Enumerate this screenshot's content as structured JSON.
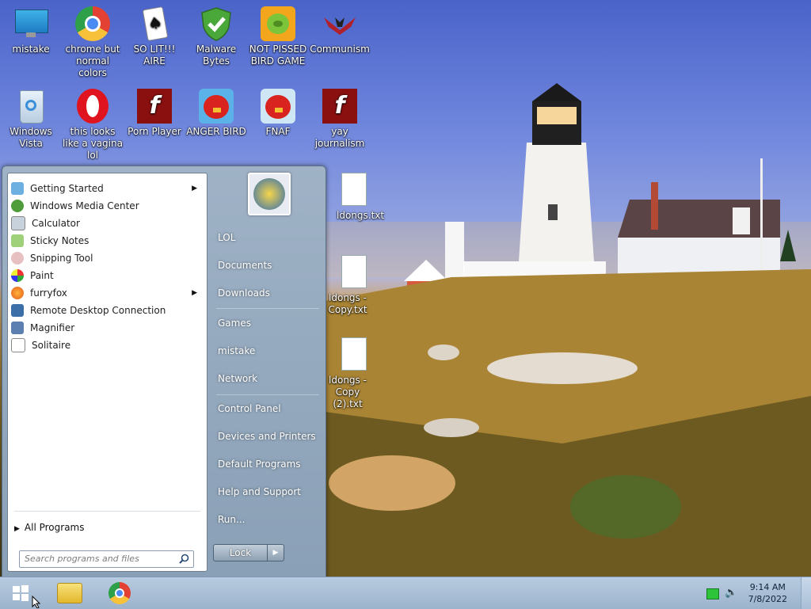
{
  "desktop_icons": [
    {
      "label": "mistake"
    },
    {
      "label": "chrome but normal colors"
    },
    {
      "label": "SO LIT!!! AIRE"
    },
    {
      "label": "Malware Bytes"
    },
    {
      "label": "NOT PISSED BIRD GAME"
    },
    {
      "label": "Communism"
    },
    {
      "label": "Windows Vista"
    },
    {
      "label": "this looks like a vagina lol"
    },
    {
      "label": "Porn Player"
    },
    {
      "label": "ANGER BIRD"
    },
    {
      "label": "FNAF"
    },
    {
      "label": "yay journalism"
    },
    {
      "label": "ldongs.txt"
    },
    {
      "label": "ldongs - Copy.txt"
    },
    {
      "label": "ldongs - Copy (2).txt"
    }
  ],
  "start_menu": {
    "programs": [
      {
        "label": "Getting Started",
        "has_submenu": true
      },
      {
        "label": "Windows Media Center",
        "has_submenu": false
      },
      {
        "label": "Calculator",
        "has_submenu": false
      },
      {
        "label": "Sticky Notes",
        "has_submenu": false
      },
      {
        "label": "Snipping Tool",
        "has_submenu": false
      },
      {
        "label": "Paint",
        "has_submenu": false
      },
      {
        "label": "furryfox",
        "has_submenu": true
      },
      {
        "label": "Remote Desktop Connection",
        "has_submenu": false
      },
      {
        "label": "Magnifier",
        "has_submenu": false
      },
      {
        "label": "Solitaire",
        "has_submenu": false
      }
    ],
    "all_programs_label": "All Programs",
    "search_placeholder": "Search programs and files",
    "right_links": [
      {
        "label": "LOL"
      },
      {
        "label": "Documents"
      },
      {
        "label": "Downloads"
      },
      {
        "label": "Games"
      },
      {
        "label": "mistake"
      },
      {
        "label": "Network"
      },
      {
        "label": "Control Panel"
      },
      {
        "label": "Devices and Printers"
      },
      {
        "label": "Default Programs"
      },
      {
        "label": "Help and Support"
      },
      {
        "label": "Run..."
      }
    ],
    "lock_label": "Lock"
  },
  "taskbar": {
    "clock_time": "9:14 AM",
    "clock_date": "7/8/2022"
  },
  "colors": {
    "start_menu_bg": "#8aa0b6",
    "taskbar_bg": "#b8cbe0",
    "sky": "#4a63c9"
  }
}
